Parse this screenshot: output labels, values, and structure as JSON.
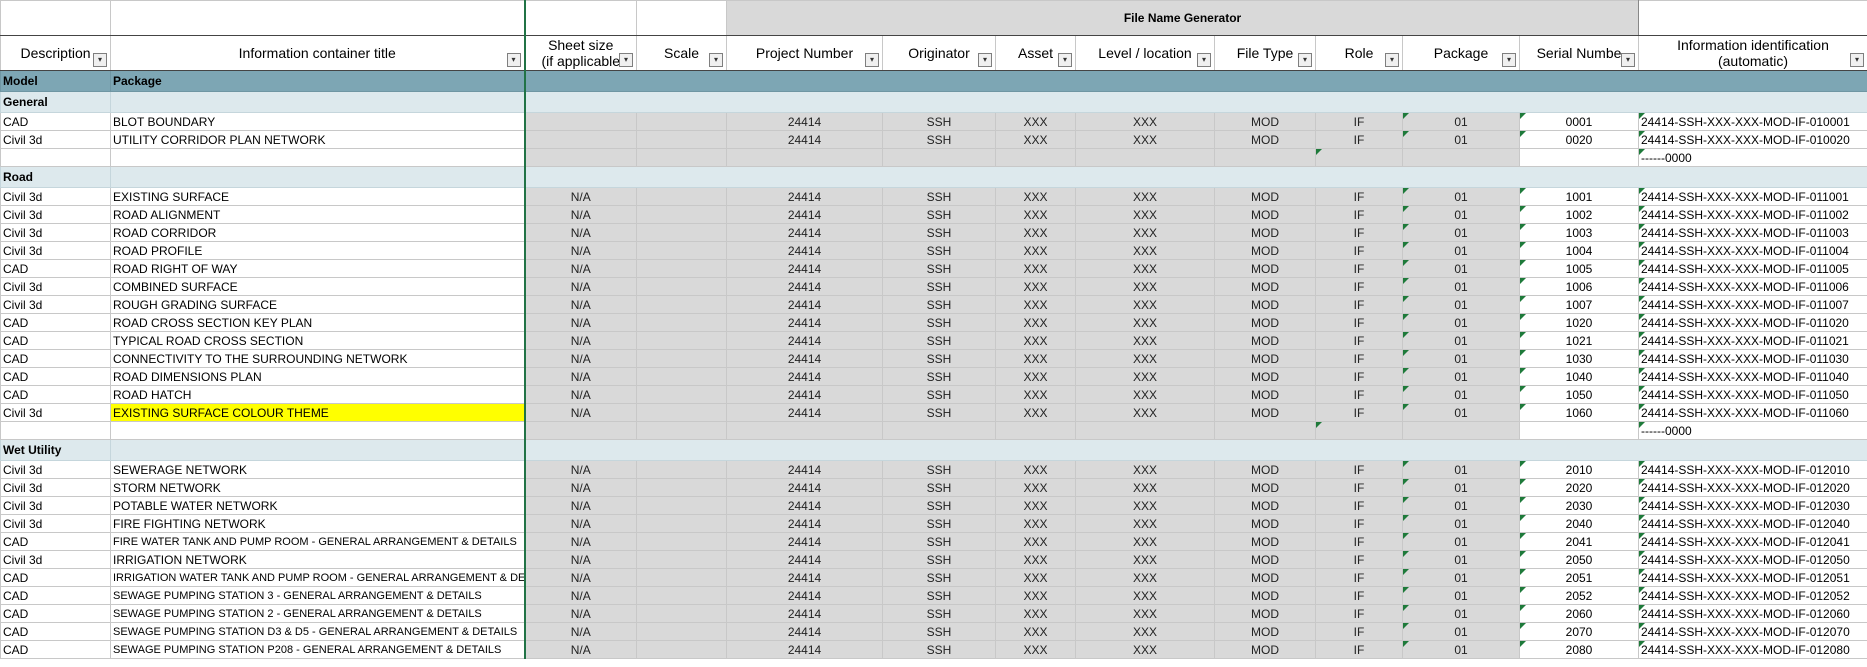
{
  "generator_title": "File Name Generator",
  "headers": {
    "description": "Description",
    "title": "Information container title",
    "sheet_size_1": "Sheet size",
    "sheet_size_2": "(if applicable",
    "scale": "Scale",
    "project": "Project Number",
    "originator": "Originator",
    "asset": "Asset",
    "level": "Level / location",
    "filetype": "File Type",
    "role": "Role",
    "package": "Package",
    "serial": "Serial Numbe",
    "info_1": "Information identification",
    "info_2": "(automatic)"
  },
  "model_row": {
    "col1": "Model",
    "col2": "Package"
  },
  "groups": {
    "general": "General",
    "road": "Road",
    "wet": "Wet Utility"
  },
  "general_rows": [
    {
      "desc": "CAD",
      "title": "BLOT BOUNDARY",
      "sheet": "",
      "scale": "",
      "project": "24414",
      "orig": "SSH",
      "asset": "XXX",
      "level": "XXX",
      "ftype": "MOD",
      "role": "IF",
      "pkg": "01",
      "serial": "0001",
      "id": "24414-SSH-XXX-XXX-MOD-IF-010001"
    },
    {
      "desc": "Civil 3d",
      "title": "UTILITY CORRIDOR PLAN NETWORK",
      "sheet": "",
      "scale": "",
      "project": "24414",
      "orig": "SSH",
      "asset": "XXX",
      "level": "XXX",
      "ftype": "MOD",
      "role": "IF",
      "pkg": "01",
      "serial": "0020",
      "id": "24414-SSH-XXX-XXX-MOD-IF-010020"
    }
  ],
  "general_blank_id": "------0000",
  "road_rows": [
    {
      "desc": "Civil 3d",
      "title": "EXISTING SURFACE",
      "sheet": "N/A",
      "scale": "",
      "project": "24414",
      "orig": "SSH",
      "asset": "XXX",
      "level": "XXX",
      "ftype": "MOD",
      "role": "IF",
      "pkg": "01",
      "serial": "1001",
      "id": "24414-SSH-XXX-XXX-MOD-IF-011001"
    },
    {
      "desc": "Civil 3d",
      "title": "ROAD ALIGNMENT",
      "sheet": "N/A",
      "scale": "",
      "project": "24414",
      "orig": "SSH",
      "asset": "XXX",
      "level": "XXX",
      "ftype": "MOD",
      "role": "IF",
      "pkg": "01",
      "serial": "1002",
      "id": "24414-SSH-XXX-XXX-MOD-IF-011002"
    },
    {
      "desc": "Civil 3d",
      "title": "ROAD CORRIDOR",
      "sheet": "N/A",
      "scale": "",
      "project": "24414",
      "orig": "SSH",
      "asset": "XXX",
      "level": "XXX",
      "ftype": "MOD",
      "role": "IF",
      "pkg": "01",
      "serial": "1003",
      "id": "24414-SSH-XXX-XXX-MOD-IF-011003"
    },
    {
      "desc": "Civil 3d",
      "title": "ROAD PROFILE",
      "sheet": "N/A",
      "scale": "",
      "project": "24414",
      "orig": "SSH",
      "asset": "XXX",
      "level": "XXX",
      "ftype": "MOD",
      "role": "IF",
      "pkg": "01",
      "serial": "1004",
      "id": "24414-SSH-XXX-XXX-MOD-IF-011004"
    },
    {
      "desc": "CAD",
      "title": "ROAD RIGHT OF WAY",
      "sheet": "N/A",
      "scale": "",
      "project": "24414",
      "orig": "SSH",
      "asset": "XXX",
      "level": "XXX",
      "ftype": "MOD",
      "role": "IF",
      "pkg": "01",
      "serial": "1005",
      "id": "24414-SSH-XXX-XXX-MOD-IF-011005"
    },
    {
      "desc": "Civil 3d",
      "title": "COMBINED SURFACE",
      "sheet": "N/A",
      "scale": "",
      "project": "24414",
      "orig": "SSH",
      "asset": "XXX",
      "level": "XXX",
      "ftype": "MOD",
      "role": "IF",
      "pkg": "01",
      "serial": "1006",
      "id": "24414-SSH-XXX-XXX-MOD-IF-011006"
    },
    {
      "desc": "Civil 3d",
      "title": "ROUGH GRADING SURFACE",
      "sheet": "N/A",
      "scale": "",
      "project": "24414",
      "orig": "SSH",
      "asset": "XXX",
      "level": "XXX",
      "ftype": "MOD",
      "role": "IF",
      "pkg": "01",
      "serial": "1007",
      "id": "24414-SSH-XXX-XXX-MOD-IF-011007"
    },
    {
      "desc": "CAD",
      "title": "ROAD CROSS SECTION KEY PLAN",
      "sheet": "N/A",
      "scale": "",
      "project": "24414",
      "orig": "SSH",
      "asset": "XXX",
      "level": "XXX",
      "ftype": "MOD",
      "role": "IF",
      "pkg": "01",
      "serial": "1020",
      "id": "24414-SSH-XXX-XXX-MOD-IF-011020"
    },
    {
      "desc": "CAD",
      "title": "TYPICAL ROAD CROSS SECTION",
      "sheet": "N/A",
      "scale": "",
      "project": "24414",
      "orig": "SSH",
      "asset": "XXX",
      "level": "XXX",
      "ftype": "MOD",
      "role": "IF",
      "pkg": "01",
      "serial": "1021",
      "id": "24414-SSH-XXX-XXX-MOD-IF-011021"
    },
    {
      "desc": "CAD",
      "title": "CONNECTIVITY TO THE SURROUNDING NETWORK",
      "sheet": "N/A",
      "scale": "",
      "project": "24414",
      "orig": "SSH",
      "asset": "XXX",
      "level": "XXX",
      "ftype": "MOD",
      "role": "IF",
      "pkg": "01",
      "serial": "1030",
      "id": "24414-SSH-XXX-XXX-MOD-IF-011030"
    },
    {
      "desc": "CAD",
      "title": "ROAD DIMENSIONS PLAN",
      "sheet": "N/A",
      "scale": "",
      "project": "24414",
      "orig": "SSH",
      "asset": "XXX",
      "level": "XXX",
      "ftype": "MOD",
      "role": "IF",
      "pkg": "01",
      "serial": "1040",
      "id": "24414-SSH-XXX-XXX-MOD-IF-011040"
    },
    {
      "desc": "CAD",
      "title": "ROAD HATCH",
      "sheet": "N/A",
      "scale": "",
      "project": "24414",
      "orig": "SSH",
      "asset": "XXX",
      "level": "XXX",
      "ftype": "MOD",
      "role": "IF",
      "pkg": "01",
      "serial": "1050",
      "id": "24414-SSH-XXX-XXX-MOD-IF-011050"
    },
    {
      "desc": "Civil 3d",
      "title": "EXISTING SURFACE COLOUR THEME",
      "sheet": "N/A",
      "scale": "",
      "project": "24414",
      "orig": "SSH",
      "asset": "XXX",
      "level": "XXX",
      "ftype": "MOD",
      "role": "IF",
      "pkg": "01",
      "serial": "1060",
      "id": "24414-SSH-XXX-XXX-MOD-IF-011060",
      "highlight": true
    }
  ],
  "road_blank_id": "------0000",
  "wet_rows": [
    {
      "desc": "Civil 3d",
      "title": "SEWERAGE NETWORK",
      "sheet": "N/A",
      "scale": "",
      "project": "24414",
      "orig": "SSH",
      "asset": "XXX",
      "level": "XXX",
      "ftype": "MOD",
      "role": "IF",
      "pkg": "01",
      "serial": "2010",
      "id": "24414-SSH-XXX-XXX-MOD-IF-012010"
    },
    {
      "desc": "Civil 3d",
      "title": "STORM NETWORK",
      "sheet": "N/A",
      "scale": "",
      "project": "24414",
      "orig": "SSH",
      "asset": "XXX",
      "level": "XXX",
      "ftype": "MOD",
      "role": "IF",
      "pkg": "01",
      "serial": "2020",
      "id": "24414-SSH-XXX-XXX-MOD-IF-012020"
    },
    {
      "desc": "Civil 3d",
      "title": "POTABLE WATER NETWORK",
      "sheet": "N/A",
      "scale": "",
      "project": "24414",
      "orig": "SSH",
      "asset": "XXX",
      "level": "XXX",
      "ftype": "MOD",
      "role": "IF",
      "pkg": "01",
      "serial": "2030",
      "id": "24414-SSH-XXX-XXX-MOD-IF-012030"
    },
    {
      "desc": "Civil 3d",
      "title": "FIRE FIGHTING NETWORK",
      "sheet": "N/A",
      "scale": "",
      "project": "24414",
      "orig": "SSH",
      "asset": "XXX",
      "level": "XXX",
      "ftype": "MOD",
      "role": "IF",
      "pkg": "01",
      "serial": "2040",
      "id": "24414-SSH-XXX-XXX-MOD-IF-012040"
    },
    {
      "desc": "CAD",
      "title": "FIRE WATER TANK AND PUMP ROOM - GENERAL ARRANGEMENT & DETAILS",
      "sheet": "N/A",
      "scale": "",
      "project": "24414",
      "orig": "SSH",
      "asset": "XXX",
      "level": "XXX",
      "ftype": "MOD",
      "role": "IF",
      "pkg": "01",
      "serial": "2041",
      "id": "24414-SSH-XXX-XXX-MOD-IF-012041",
      "small": true
    },
    {
      "desc": "Civil 3d",
      "title": "IRRIGATION NETWORK",
      "sheet": "N/A",
      "scale": "",
      "project": "24414",
      "orig": "SSH",
      "asset": "XXX",
      "level": "XXX",
      "ftype": "MOD",
      "role": "IF",
      "pkg": "01",
      "serial": "2050",
      "id": "24414-SSH-XXX-XXX-MOD-IF-012050"
    },
    {
      "desc": "CAD",
      "title": "IRRIGATION WATER TANK AND PUMP ROOM - GENERAL ARRANGEMENT & DETAILS",
      "sheet": "N/A",
      "scale": "",
      "project": "24414",
      "orig": "SSH",
      "asset": "XXX",
      "level": "XXX",
      "ftype": "MOD",
      "role": "IF",
      "pkg": "01",
      "serial": "2051",
      "id": "24414-SSH-XXX-XXX-MOD-IF-012051",
      "small": true
    },
    {
      "desc": "CAD",
      "title": "SEWAGE PUMPING STATION 3 - GENERAL ARRANGEMENT & DETAILS",
      "sheet": "N/A",
      "scale": "",
      "project": "24414",
      "orig": "SSH",
      "asset": "XXX",
      "level": "XXX",
      "ftype": "MOD",
      "role": "IF",
      "pkg": "01",
      "serial": "2052",
      "id": "24414-SSH-XXX-XXX-MOD-IF-012052",
      "small": true
    },
    {
      "desc": "CAD",
      "title": "SEWAGE PUMPING STATION 2 - GENERAL ARRANGEMENT & DETAILS",
      "sheet": "N/A",
      "scale": "",
      "project": "24414",
      "orig": "SSH",
      "asset": "XXX",
      "level": "XXX",
      "ftype": "MOD",
      "role": "IF",
      "pkg": "01",
      "serial": "2060",
      "id": "24414-SSH-XXX-XXX-MOD-IF-012060",
      "small": true
    },
    {
      "desc": "CAD",
      "title": "SEWAGE PUMPING STATION D3 & D5 - GENERAL ARRANGEMENT & DETAILS",
      "sheet": "N/A",
      "scale": "",
      "project": "24414",
      "orig": "SSH",
      "asset": "XXX",
      "level": "XXX",
      "ftype": "MOD",
      "role": "IF",
      "pkg": "01",
      "serial": "2070",
      "id": "24414-SSH-XXX-XXX-MOD-IF-012070",
      "small": true
    },
    {
      "desc": "CAD",
      "title": "SEWAGE PUMPING STATION P208 - GENERAL ARRANGEMENT & DETAILS",
      "sheet": "N/A",
      "scale": "",
      "project": "24414",
      "orig": "SSH",
      "asset": "XXX",
      "level": "XXX",
      "ftype": "MOD",
      "role": "IF",
      "pkg": "01",
      "serial": "2080",
      "id": "24414-SSH-XXX-XXX-MOD-IF-012080",
      "small": true
    }
  ],
  "filter_icon_glyph": "▾"
}
